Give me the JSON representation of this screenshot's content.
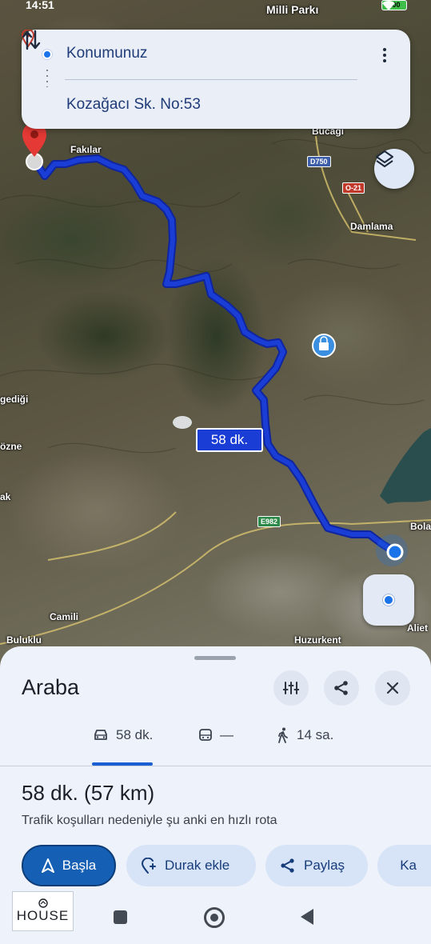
{
  "status_bar": {
    "time": "14:51",
    "battery": "100"
  },
  "search": {
    "origin": "Konumunuz",
    "destination": "Kozağacı Sk. No:53"
  },
  "map": {
    "place_labels": {
      "milli_park": "Milli Parkı",
      "fakilar": "Fakılar",
      "bucagi": "Bucağı",
      "damlama": "Damlama",
      "gedigi": "gediği",
      "ozne": "özne",
      "ak": "ak",
      "bola": "Bola",
      "camili": "Camili",
      "buluklu": "Buluklu",
      "huzurkent": "Huzurkent",
      "aliet": "Aliet"
    },
    "road_shields": {
      "d750": "D750",
      "o21": "O-21",
      "e982": "E982"
    },
    "route_time_badge": "58 dk.",
    "colors": {
      "route": "#1a3dd6",
      "route_outline": "#0f25a0",
      "origin": "#1a73e8",
      "destination_pin": "#e53935"
    }
  },
  "sheet": {
    "title": "Araba",
    "tabs": [
      {
        "label": "58 dk.",
        "icon": "car-icon",
        "selected": true
      },
      {
        "label": "—",
        "icon": "transit-icon",
        "selected": false
      },
      {
        "label": "14 sa.",
        "icon": "walk-icon",
        "selected": false
      }
    ],
    "summary": "58 dk. (57 km)",
    "subtext": "Trafik koşulları nedeniyle şu anki en hızlı rota",
    "actions": {
      "start": "Başla",
      "add_stop": "Durak ekle",
      "share": "Paylaş",
      "save": "Ka"
    }
  },
  "watermark": {
    "text": "HOUSE"
  }
}
